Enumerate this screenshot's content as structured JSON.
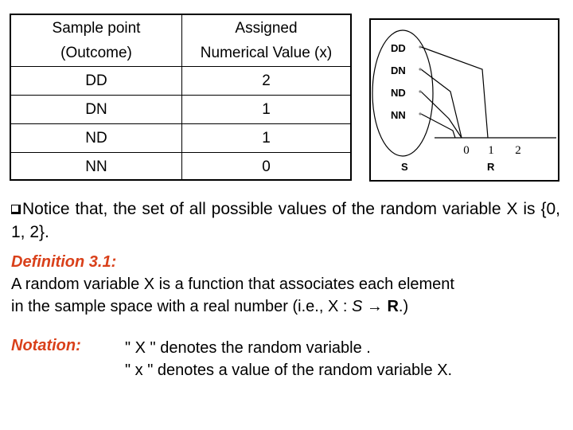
{
  "table": {
    "headers": [
      {
        "line1": "Sample point",
        "line2": "(Outcome)"
      },
      {
        "line1": "Assigned",
        "line2": "Numerical Value (x)"
      }
    ],
    "rows": [
      {
        "outcome": "DD",
        "value": "2"
      },
      {
        "outcome": "DN",
        "value": "1"
      },
      {
        "outcome": "ND",
        "value": "1"
      },
      {
        "outcome": "NN",
        "value": "0"
      }
    ]
  },
  "diagram": {
    "sample_space_label": "S",
    "real_line_label": "R",
    "outcomes": [
      "DD",
      "DN",
      "ND",
      "NN"
    ],
    "ticks": [
      "0",
      "1",
      "2"
    ],
    "mapping": {
      "DD": 2,
      "DN": 1,
      "ND": 1,
      "NN": 0
    }
  },
  "notice": {
    "text": "Notice that, the set of all possible values of the random variable X is {0, 1, 2}."
  },
  "definition": {
    "title": "Definition 3.1:",
    "line1": "A random variable X is a function that associates each element",
    "line2_prefix": "in the sample space with a real number (i.e., X : ",
    "line2_S": "S",
    "line2_arrow": " → ",
    "line2_R": "R",
    "line2_suffix": ".)"
  },
  "notation": {
    "title": "Notation:",
    "line1": "\" X \" denotes the random variable .",
    "line2": "\" x \" denotes a value of the random variable X."
  },
  "colors": {
    "accent": "#d9401a"
  }
}
